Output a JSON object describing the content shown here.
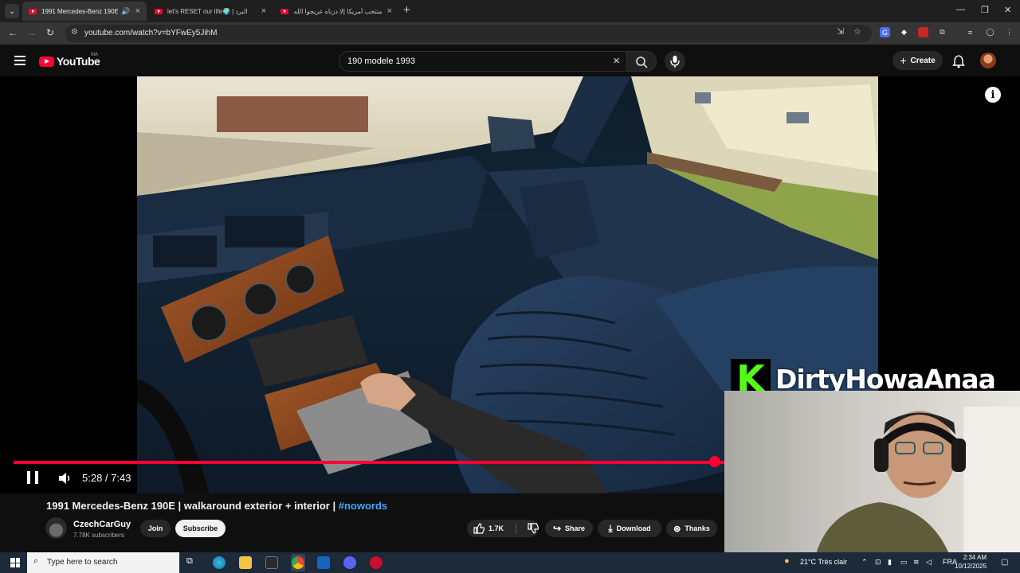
{
  "browser": {
    "tabs": [
      {
        "title": "1991 Mercedes-Benz 190E",
        "active": true,
        "audio": true
      },
      {
        "title": "let's RESET our life🌍 | البرد",
        "active": false
      },
      {
        "title": "منتخب أمريكا إلا دزناه عريجوا الله",
        "active": false
      }
    ],
    "url": "youtube.com/watch?v=bYFwEy5JihM",
    "new_tab_glyph": "+",
    "close_glyph": "×"
  },
  "youtube": {
    "logo_text": "YouTube",
    "country_code": "MA",
    "search_value": "190 modele 1993",
    "create_label": "Create"
  },
  "player": {
    "current_time": "5:28",
    "duration": "7:43",
    "time_display": "5:28 / 7:43",
    "progress_fraction": 0.708,
    "overlay_brand": "DirtyHowaAnaa",
    "overlay_letter": "K"
  },
  "video": {
    "title": "1991 Mercedes-Benz 190E | walkaround exterior + interior |",
    "hashtag": "#nowords",
    "channel_name": "CzechCarGuy",
    "subscribers": "7.78K subscribers",
    "join_label": "Join",
    "subscribe_label": "Subscribe",
    "likes": "1.7K",
    "share_label": "Share",
    "download_label": "Download",
    "thanks_label": "Thanks"
  },
  "taskbar": {
    "search_placeholder": "Type here to search",
    "weather": "21°C  Très clair",
    "language": "FRA",
    "time": "2:34 AM",
    "date": "10/12/2025"
  },
  "colors": {
    "accent_red": "#ff0033",
    "link_blue": "#3ea6ff",
    "kick_green": "#53fc18"
  }
}
